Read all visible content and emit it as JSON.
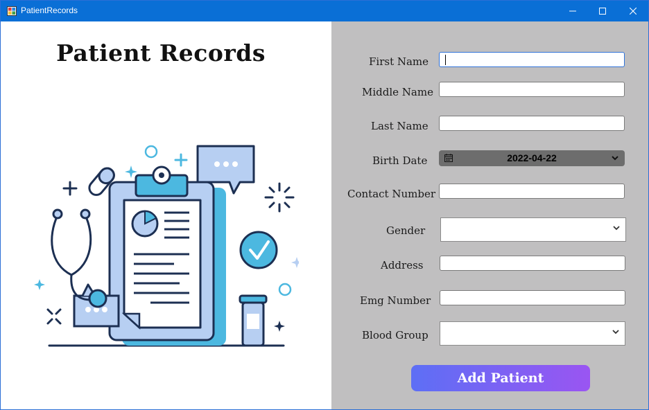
{
  "window": {
    "title": "PatientRecords"
  },
  "header": {
    "title": "Patient Records"
  },
  "form": {
    "first_name": {
      "label": "First Name",
      "value": ""
    },
    "middle_name": {
      "label": "Middle Name",
      "value": ""
    },
    "last_name": {
      "label": "Last Name",
      "value": ""
    },
    "birth_date": {
      "label": "Birth Date",
      "value": "2022-04-22"
    },
    "contact_number": {
      "label": "Contact Number",
      "value": ""
    },
    "gender": {
      "label": "Gender",
      "value": ""
    },
    "address": {
      "label": "Address",
      "value": ""
    },
    "emg_number": {
      "label": "Emg Number",
      "value": ""
    },
    "blood_group": {
      "label": "Blood Group",
      "value": ""
    }
  },
  "actions": {
    "add_patient_label": "Add Patient"
  },
  "colors": {
    "titlebar": "#0a6fd6",
    "form_panel": "#c0bfc0",
    "button_gradient_start": "#5d6ff5",
    "button_gradient_end": "#9a55f2",
    "illustration_navy": "#1c2f52",
    "illustration_blue": "#4cb8e0",
    "illustration_light_blue": "#b7cff2"
  },
  "icons": {
    "app": "app-icon",
    "minimize": "minimize-icon",
    "maximize": "maximize-icon",
    "close": "close-icon",
    "calendar": "calendar-icon",
    "dropdown": "chevron-down-icon",
    "illustration": "medical-records-illustration"
  }
}
